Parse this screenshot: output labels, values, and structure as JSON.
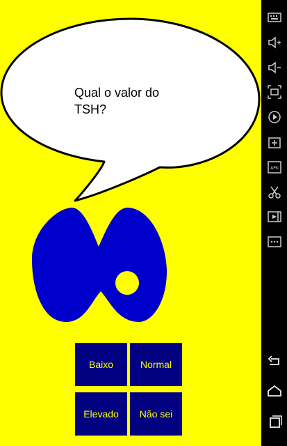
{
  "colors": {
    "background": "#FFFF00",
    "button_bg": "#000080",
    "button_text": "#FFFF00",
    "thyroid": "#0000CC",
    "bubble_fill": "#FFFFFF",
    "navbar": "#000000"
  },
  "speech_bubble": {
    "question": "Qual o valor do TSH?"
  },
  "illustration": {
    "icon": "thyroid-icon"
  },
  "answers": [
    {
      "label": "Baixo"
    },
    {
      "label": "Normal"
    },
    {
      "label": "Elevado"
    },
    {
      "label": "Não sei"
    }
  ],
  "side_toolbar": {
    "items": [
      "keyboard-icon",
      "volume-up-icon",
      "volume-down-icon",
      "screenshot-icon",
      "rotate-icon",
      "add-window-icon",
      "apk-icon",
      "scissors-icon",
      "video-icon",
      "more-icon"
    ],
    "apk_text": "APK",
    "nav": [
      "back-icon",
      "home-icon",
      "recents-icon"
    ]
  }
}
